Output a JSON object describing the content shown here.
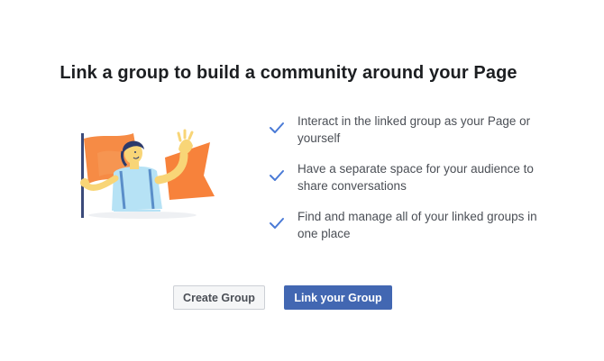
{
  "heading": "Link a group to build a community around your Page",
  "illustration": {
    "icon": "person-waving-flag-illustration"
  },
  "benefits": [
    {
      "icon": "checkmark-icon",
      "text": "Interact in the linked group as your Page or yourself"
    },
    {
      "icon": "checkmark-icon",
      "text": "Have a separate space for your audience to share conversations"
    },
    {
      "icon": "checkmark-icon",
      "text": "Find and manage all of your linked groups in one place"
    }
  ],
  "actions": {
    "create_label": "Create Group",
    "link_label": "Link your Group"
  },
  "colors": {
    "primary": "#4267b2",
    "check": "#4a7ad6",
    "flag": "#f7823b",
    "shirt": "#b6e2f5",
    "skin": "#f8d577"
  }
}
